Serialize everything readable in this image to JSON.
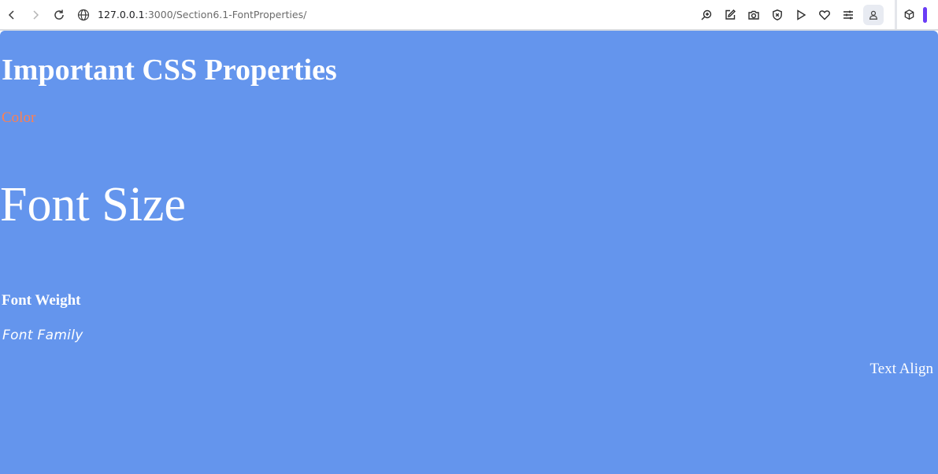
{
  "browser": {
    "url_host": "127.0.0.1",
    "url_rest": ":3000/Section6.1-FontProperties/"
  },
  "toolbar": {
    "icons": [
      "zoom-icon",
      "edit-icon",
      "camera-icon",
      "shield-icon",
      "play-icon",
      "heart-icon",
      "sliders-icon",
      "profile-icon",
      "extension-cube-icon"
    ]
  },
  "page": {
    "background": "#6495ed",
    "heading": "Important CSS Properties",
    "color_label": "Color",
    "color_value": "#ff7f50",
    "font_size_label": "Font Size",
    "font_weight_label": "Font Weight",
    "font_family_label": "Font Family",
    "text_align_label": "Text Align"
  }
}
